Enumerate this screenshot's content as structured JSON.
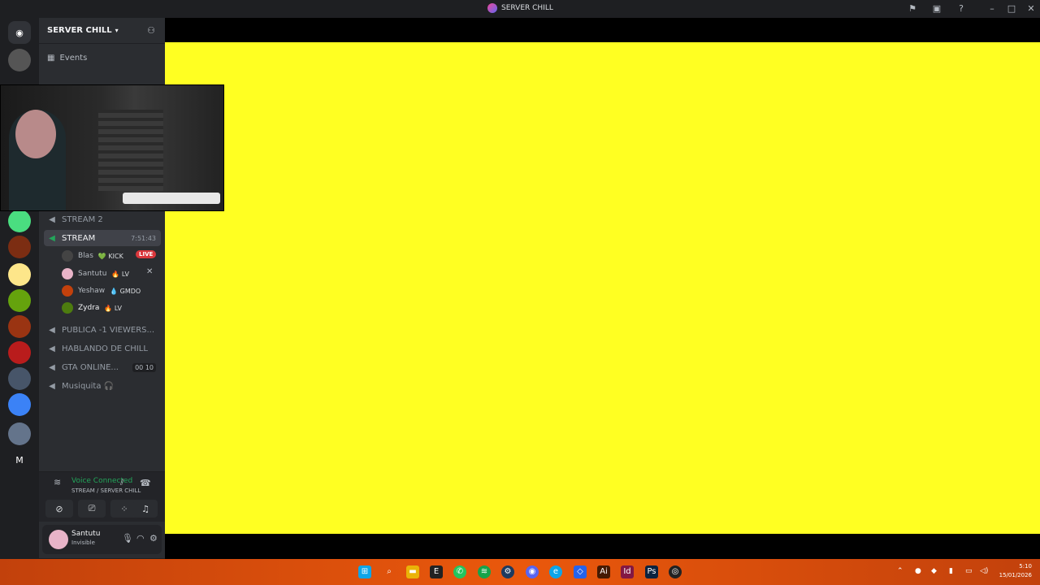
{
  "window": {
    "title": "SERVER CHILL"
  },
  "server": {
    "name": "SERVER CHILL"
  },
  "events_label": "Events",
  "channels": [
    {
      "name": "STREAM 2"
    },
    {
      "name": "STREAM",
      "timer": "7:51:43",
      "active": true
    },
    {
      "name": "PUBLICA -1 VIEWERS..."
    },
    {
      "name": "HABLANDO DE CHILL"
    },
    {
      "name": "GTA ONLINE...",
      "count": "00  10"
    },
    {
      "name": "Musiquita 🎧"
    }
  ],
  "voice_users": [
    {
      "name": "Blas",
      "tag": "💚 KICK",
      "live": "LIVE"
    },
    {
      "name": "Santutu",
      "tag": "🔥 LV"
    },
    {
      "name": "Yeshaw",
      "tag": "💧 GMDO"
    },
    {
      "name": "Zydra",
      "tag": "🔥 LV"
    }
  ],
  "voice": {
    "status": "Voice Connected",
    "sub": "STREAM / SERVER CHILL"
  },
  "user": {
    "name": "Santutu",
    "status": "Invisible"
  },
  "rail_last": "M",
  "clock": {
    "time": "5:10",
    "date": "15/01/2026"
  }
}
